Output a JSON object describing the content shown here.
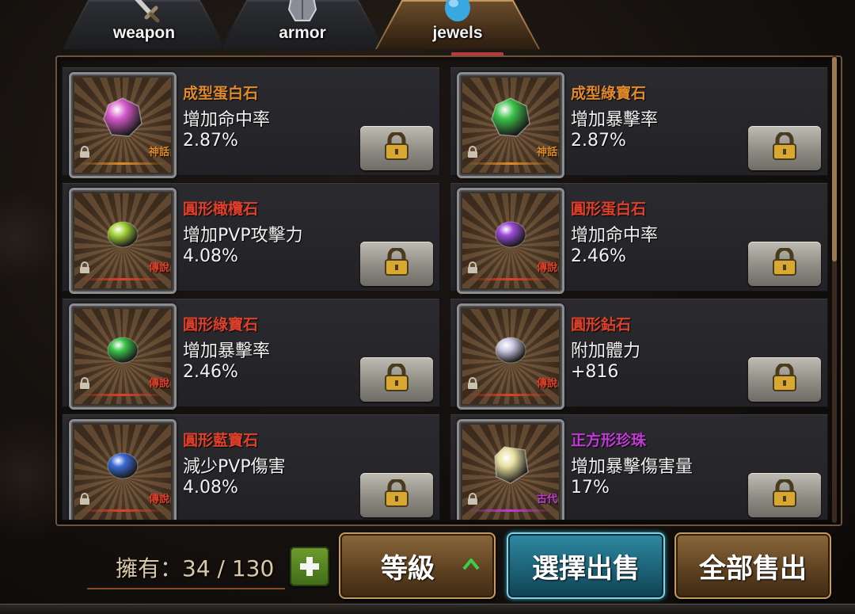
{
  "tabs": [
    {
      "label": "weapon",
      "icon": "sword-icon",
      "active": false
    },
    {
      "label": "armor",
      "icon": "armor-icon",
      "active": false
    },
    {
      "label": "jewels",
      "icon": "jewel-icon",
      "active": true
    }
  ],
  "items": [
    {
      "name": "成型蛋白石",
      "stat": "增加命中率",
      "value": "2.87%",
      "rarity": "神話",
      "name_color": "#e08a2a",
      "rarity_color": "#e08a2a",
      "gem": "opal-gem-icon",
      "gem_color": "#d65acb"
    },
    {
      "name": "成型綠寶石",
      "stat": "增加暴擊率",
      "value": "2.87%",
      "rarity": "神話",
      "name_color": "#e08a2a",
      "rarity_color": "#e08a2a",
      "gem": "emerald-gem-icon",
      "gem_color": "#3bc24a"
    },
    {
      "name": "圓形橄欖石",
      "stat": "增加PVP攻擊力",
      "value": "4.08%",
      "rarity": "傳說",
      "name_color": "#e0402a",
      "rarity_color": "#e0402a",
      "gem": "peridot-gem-icon",
      "gem_color": "#a6d43a"
    },
    {
      "name": "圓形蛋白石",
      "stat": "增加命中率",
      "value": "2.46%",
      "rarity": "傳說",
      "name_color": "#e0402a",
      "rarity_color": "#e0402a",
      "gem": "opal-gem-icon",
      "gem_color": "#9b4ad6"
    },
    {
      "name": "圓形綠寶石",
      "stat": "增加暴擊率",
      "value": "2.46%",
      "rarity": "傳說",
      "name_color": "#e0402a",
      "rarity_color": "#e0402a",
      "gem": "emerald-gem-icon",
      "gem_color": "#3bc24a"
    },
    {
      "name": "圓形鉆石",
      "stat": "附加體力",
      "value": "+816",
      "rarity": "傳說",
      "name_color": "#e0402a",
      "rarity_color": "#e0402a",
      "gem": "diamond-gem-icon",
      "gem_color": "#c9c6e0"
    },
    {
      "name": "圓形藍寶石",
      "stat": "減少PVP傷害",
      "value": "4.08%",
      "rarity": "傳說",
      "name_color": "#e0402a",
      "rarity_color": "#e0402a",
      "gem": "sapphire-gem-icon",
      "gem_color": "#3a6ad6"
    },
    {
      "name": "正方形珍珠",
      "stat": "增加暴擊傷害量",
      "value": "17%",
      "rarity": "古代",
      "name_color": "#c23ad6",
      "rarity_color": "#c23ad6",
      "gem": "pearl-gem-icon",
      "gem_color": "#e8dfa0"
    }
  ],
  "owned": {
    "label": "擁有",
    "count": "34",
    "capacity": "130",
    "text": "擁有：34 / 130"
  },
  "buttons": {
    "grade": "等級",
    "select_sell": "選擇出售",
    "sell_all": "全部售出"
  },
  "colors": {
    "accent_teal": "#2e8aa3",
    "frame_brown": "#6b543a"
  }
}
